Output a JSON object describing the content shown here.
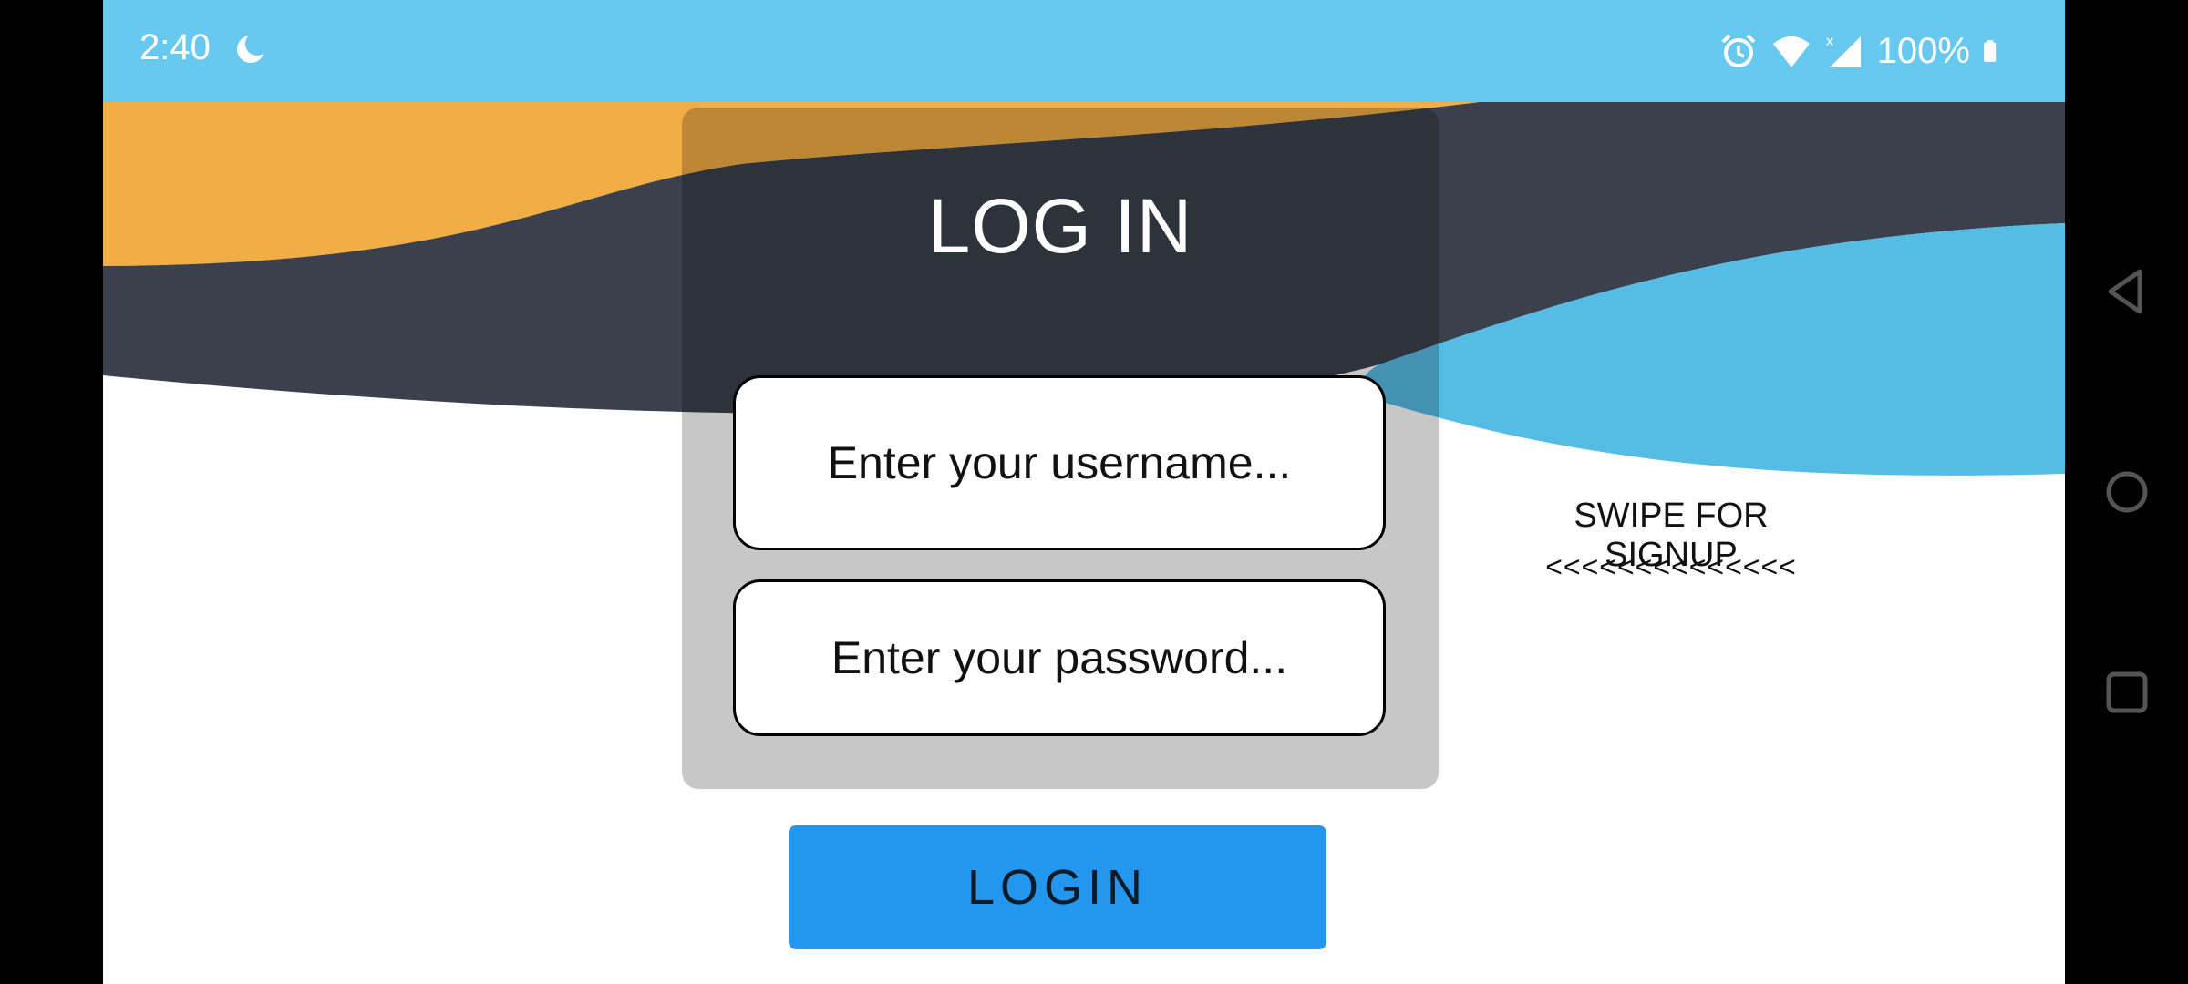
{
  "status_bar": {
    "time": "2:40",
    "battery": "100%",
    "icons": [
      "moon-icon",
      "alarm-icon",
      "wifi-icon",
      "signal-icon",
      "battery-icon"
    ]
  },
  "login_card": {
    "title": "LOG IN",
    "username_placeholder": "Enter your username...",
    "password_placeholder": "Enter your password..."
  },
  "login_button": {
    "label": "LOGIN"
  },
  "swipe_hint": {
    "label": "SWIPE FOR SIGNUP",
    "arrows": "<<<<<<<<<<<<<<"
  },
  "nav_bar": {
    "icons": [
      "back-icon",
      "home-icon",
      "recents-icon"
    ]
  },
  "colors": {
    "status_bar": "#67c8f0",
    "wave_orange": "#f2ad45",
    "wave_dark": "#3a414c",
    "wave_blue": "#55bce6",
    "button": "#2396f0"
  }
}
